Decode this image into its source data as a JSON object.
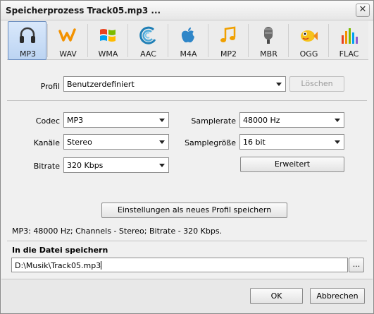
{
  "window": {
    "title": "Speicherprozess Track05.mp3 ...",
    "close_glyph": "✕"
  },
  "formats": [
    {
      "label": "MP3",
      "icon": "headphones-icon",
      "active": true
    },
    {
      "label": "WAV",
      "icon": "wav-wave-icon",
      "active": false
    },
    {
      "label": "WMA",
      "icon": "windows-logo-icon",
      "active": false
    },
    {
      "label": "AAC",
      "icon": "aac-swirl-icon",
      "active": false
    },
    {
      "label": "M4A",
      "icon": "apple-logo-icon",
      "active": false
    },
    {
      "label": "MP2",
      "icon": "music-note-icon",
      "active": false
    },
    {
      "label": "MBR",
      "icon": "microphone-icon",
      "active": false
    },
    {
      "label": "OGG",
      "icon": "fish-icon",
      "active": false
    },
    {
      "label": "FLAC",
      "icon": "equalizer-bars-icon",
      "active": false
    }
  ],
  "profile": {
    "label": "Profil",
    "value": "Benutzerdefiniert",
    "delete_label": "Löschen"
  },
  "settings": {
    "codec": {
      "label": "Codec",
      "value": "MP3"
    },
    "channels": {
      "label": "Kanäle",
      "value": "Stereo"
    },
    "bitrate": {
      "label": "Bitrate",
      "value": "320 Kbps"
    },
    "samplerate": {
      "label": "Samplerate",
      "value": "48000 Hz"
    },
    "samplesize": {
      "label": "Samplegröße",
      "value": "16 bit"
    },
    "advanced_label": "Erweitert"
  },
  "save_profile_label": "Einstellungen als neues Profil speichern",
  "info_text": "MP3: 48000  Hz; Channels - Stereo; Bitrate - 320 Kbps.",
  "save_file": {
    "heading": "In die Datei speichern",
    "path": "D:\\Musik\\Track05.mp3",
    "browse_label": "..."
  },
  "footer": {
    "ok_label": "OK",
    "cancel_label": "Abbrechen"
  },
  "colors": {
    "active_tab": "#bcd4f2",
    "accent_orange": "#f39200",
    "windows_red": "#e8421f",
    "windows_green": "#7cbb00",
    "windows_blue": "#00a1f1",
    "windows_yellow": "#ffbb00"
  }
}
